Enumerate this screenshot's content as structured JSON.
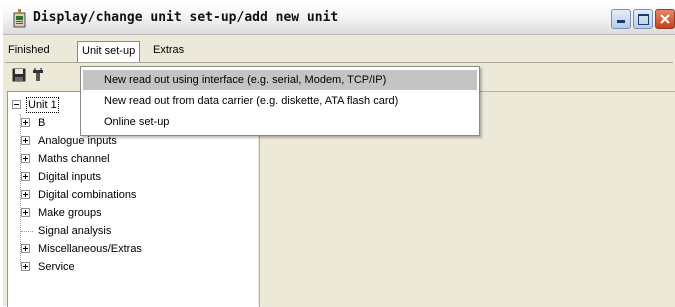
{
  "window": {
    "title": "Display/change unit set-up/add new unit"
  },
  "menubar": {
    "items": [
      {
        "label": "Finished"
      },
      {
        "label": "Unit set-up"
      },
      {
        "label": "Extras"
      }
    ]
  },
  "dropdown": {
    "items": [
      {
        "label": "New read out using interface (e.g. serial, Modem, TCP/IP)"
      },
      {
        "label": "New read out from data carrier (e.g. diskette, ATA flash card)"
      },
      {
        "label": "Online set-up"
      }
    ]
  },
  "toolbar": {
    "icons": [
      "save-icon",
      "tool-icon"
    ]
  },
  "tree": {
    "root": {
      "label": "Unit 1"
    },
    "items": [
      {
        "label": "B",
        "expandable": true
      },
      {
        "label": "Analogue inputs",
        "expandable": true
      },
      {
        "label": "Maths channel",
        "expandable": true
      },
      {
        "label": "Digital inputs",
        "expandable": true
      },
      {
        "label": "Digital combinations",
        "expandable": true
      },
      {
        "label": "Make groups",
        "expandable": true
      },
      {
        "label": "Signal analysis",
        "expandable": false
      },
      {
        "label": "Miscellaneous/Extras",
        "expandable": true
      },
      {
        "label": "Service",
        "expandable": true
      }
    ]
  }
}
